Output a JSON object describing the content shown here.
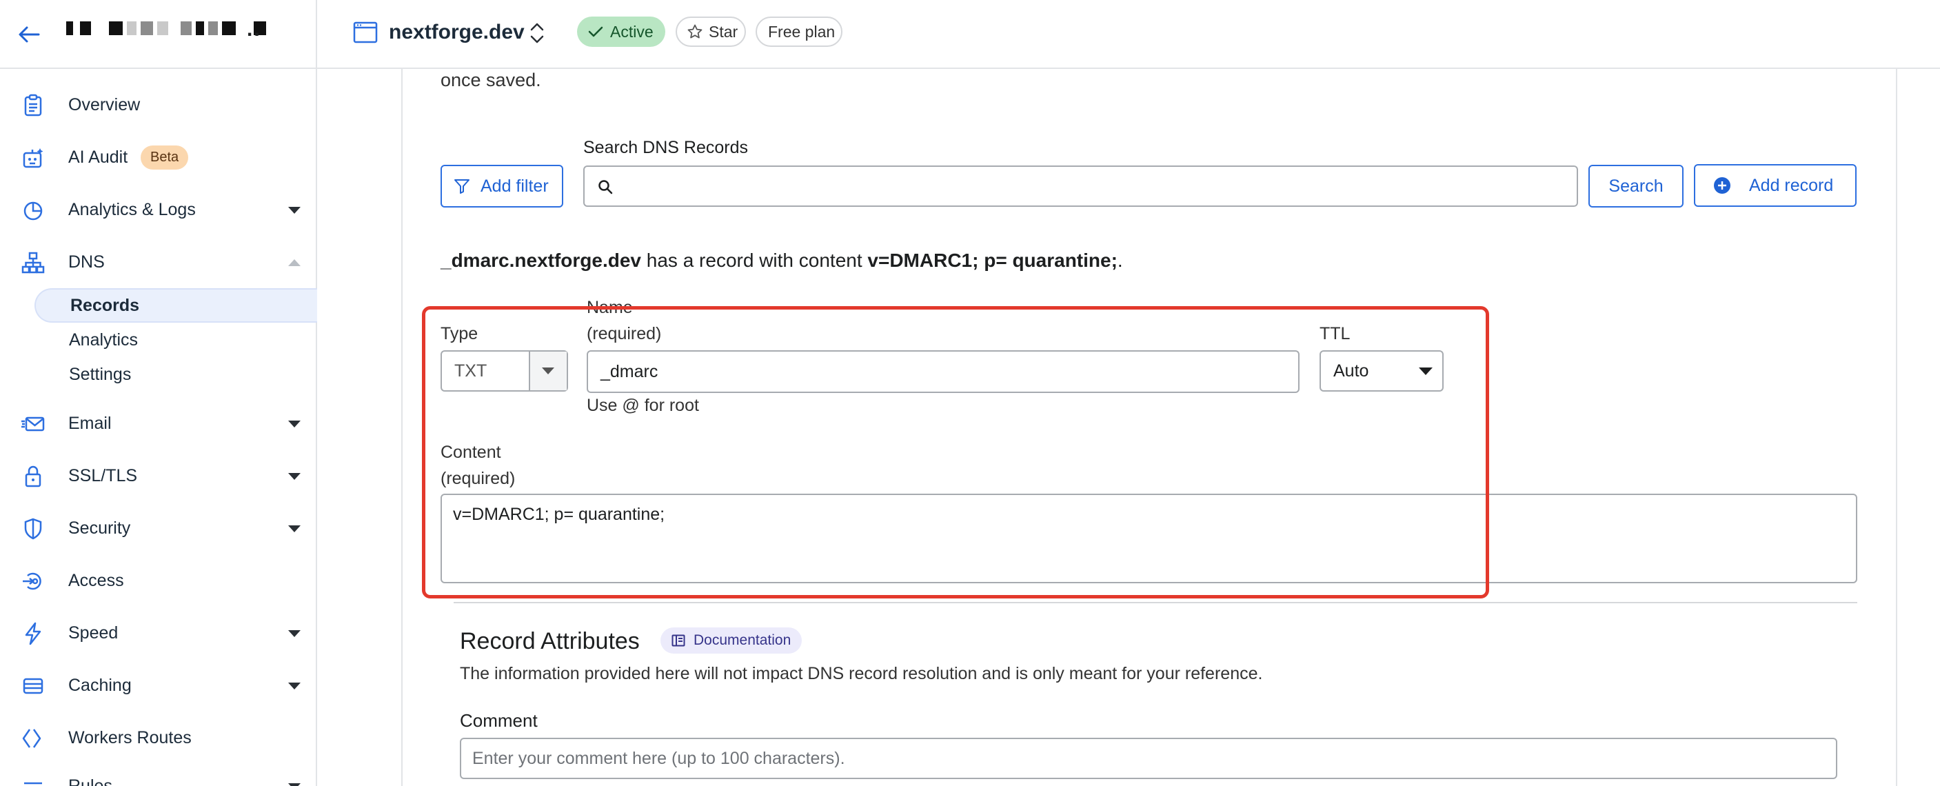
{
  "account": {
    "back_label": "Back",
    "more": ".."
  },
  "sidebar": {
    "items": [
      {
        "label": "Overview",
        "icon": "clipboard-icon"
      },
      {
        "label": "AI Audit",
        "icon": "robot-icon",
        "badge": "Beta"
      },
      {
        "label": "Analytics & Logs",
        "icon": "pie-chart-icon",
        "expandable": true
      },
      {
        "label": "DNS",
        "icon": "network-icon",
        "expanded": true
      },
      {
        "label": "Email",
        "icon": "email-icon",
        "expandable": true
      },
      {
        "label": "SSL/TLS",
        "icon": "lock-icon",
        "expandable": true
      },
      {
        "label": "Security",
        "icon": "shield-icon",
        "expandable": true
      },
      {
        "label": "Access",
        "icon": "access-icon"
      },
      {
        "label": "Speed",
        "icon": "lightning-icon",
        "expandable": true
      },
      {
        "label": "Caching",
        "icon": "storage-icon",
        "expandable": true
      },
      {
        "label": "Workers Routes",
        "icon": "workers-icon"
      },
      {
        "label": "Rules",
        "icon": "rules-icon",
        "expandable": true
      }
    ],
    "dns_subitems": [
      "Records",
      "Analytics",
      "Settings"
    ],
    "active_subitem": "Records"
  },
  "topbar": {
    "site_name": "nextforge.dev",
    "status": "Active",
    "star_label": "Star",
    "plan": "Free plan"
  },
  "main": {
    "intro_tail": "once saved.",
    "search": {
      "label": "Search DNS Records",
      "add_filter": "Add filter",
      "search_button": "Search",
      "add_record": "Add record",
      "placeholder": ""
    },
    "summary": {
      "host": "_dmarc.nextforge.dev",
      "middle": " has a record with content ",
      "content": "v=DMARC1; p= quarantine;",
      "end": "."
    },
    "form": {
      "type_label": "Type",
      "type_value": "TXT",
      "name_label": "Name",
      "name_required": "(required)",
      "name_value": "_dmarc",
      "name_hint": "Use @ for root",
      "ttl_label": "TTL",
      "ttl_value": "Auto",
      "content_label": "Content",
      "content_required": "(required)",
      "content_value": "v=DMARC1; p= quarantine;"
    },
    "attributes": {
      "title": "Record Attributes",
      "doc_label": "Documentation",
      "description": "The information provided here will not impact DNS record resolution and is only meant for your reference.",
      "comment_label": "Comment",
      "comment_placeholder": "Enter your comment here (up to 100 characters)."
    }
  },
  "colors": {
    "accent": "#2d6fe0",
    "highlight": "#e3392c",
    "active_pill": "#b9e6c3",
    "beta": "#fbd7ae"
  }
}
